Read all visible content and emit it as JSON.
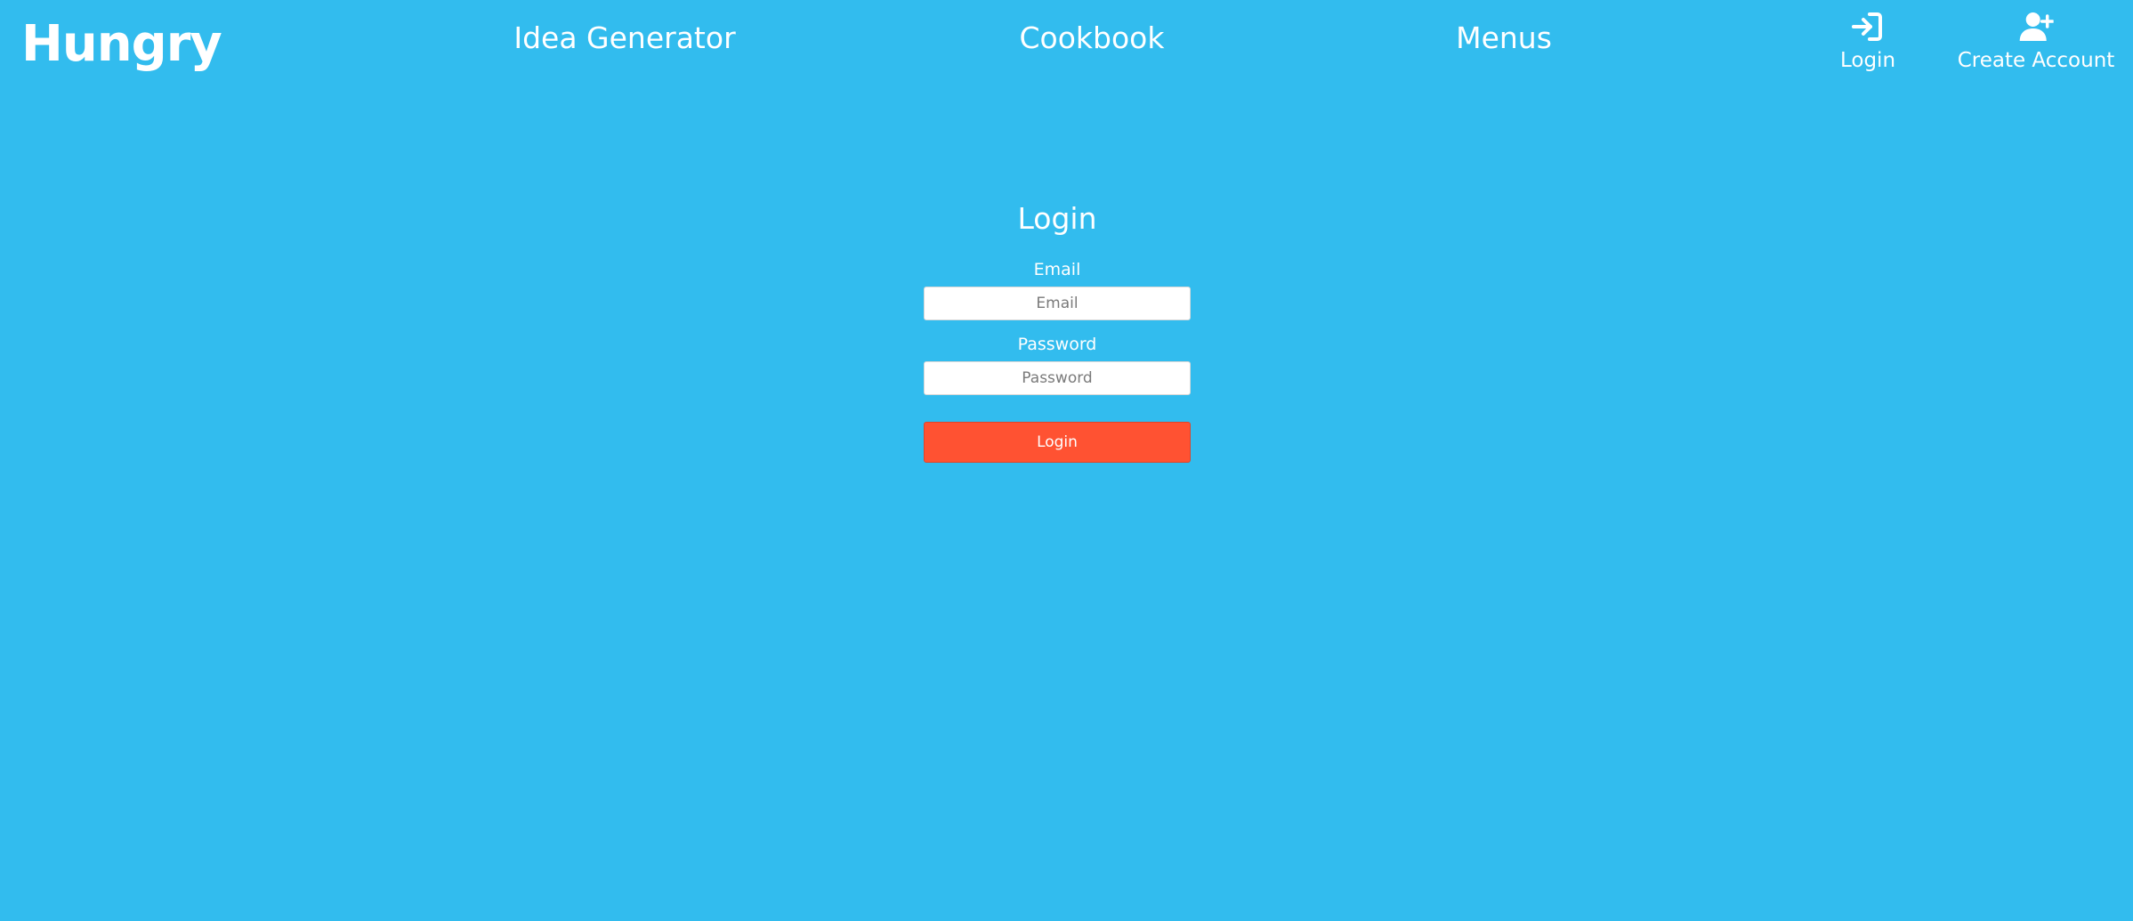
{
  "brand": {
    "name": "Hungry"
  },
  "nav": {
    "links": [
      {
        "label": "Idea Generator"
      },
      {
        "label": "Cookbook"
      },
      {
        "label": "Menus"
      }
    ],
    "actions": {
      "login": {
        "label": "Login",
        "icon": "login-arrow-icon"
      },
      "create_account": {
        "label": "Create Account",
        "icon": "user-plus-icon"
      }
    }
  },
  "login_form": {
    "title": "Login",
    "email": {
      "label": "Email",
      "placeholder": "Email",
      "value": ""
    },
    "password": {
      "label": "Password",
      "placeholder": "Password",
      "value": ""
    },
    "submit_label": "Login"
  },
  "colors": {
    "background": "#32bcee",
    "button": "#ff5232",
    "text": "#ffffff"
  }
}
